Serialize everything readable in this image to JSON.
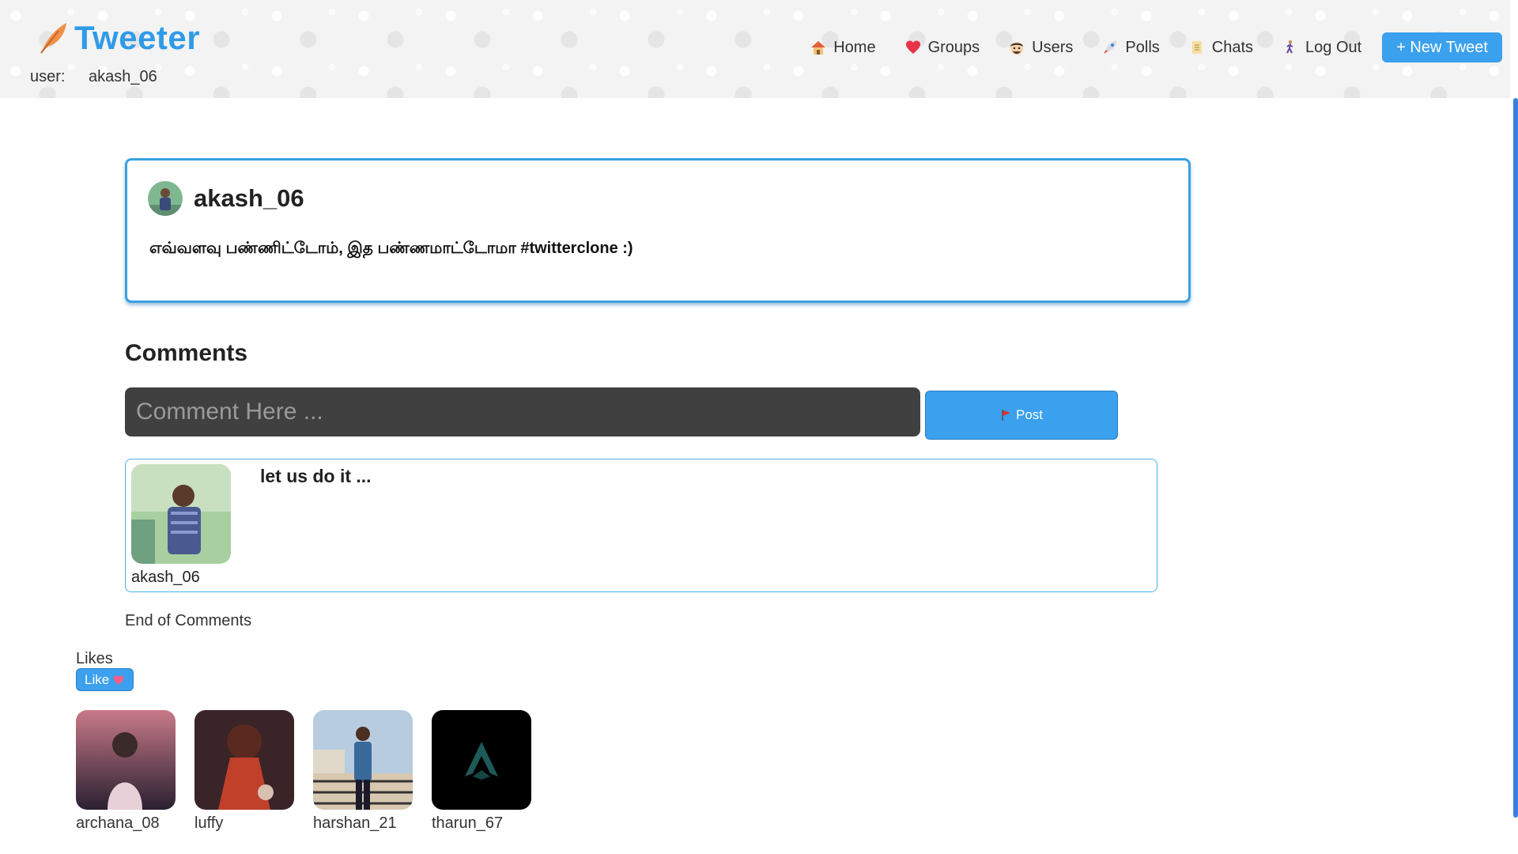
{
  "app": {
    "title": "Tweeter"
  },
  "user": {
    "label": "user:",
    "name": "akash_06"
  },
  "nav": {
    "items": [
      {
        "label": "Home",
        "icon": "house-icon"
      },
      {
        "label": "Groups",
        "icon": "heart-icon"
      },
      {
        "label": "Users",
        "icon": "face-icon"
      },
      {
        "label": "Polls",
        "icon": "rocket-icon"
      },
      {
        "label": "Chats",
        "icon": "scroll-icon"
      },
      {
        "label": "Log Out",
        "icon": "person-walking-icon"
      }
    ],
    "new_tweet": "+ New Tweet"
  },
  "tweet": {
    "author": "akash_06",
    "text": "எவ்வளவு பண்ணிட்டோம், இத பண்ணமாட்டோமா #twitterclone :)"
  },
  "comments": {
    "title": "Comments",
    "input_placeholder": "Comment Here ...",
    "post_label": "Post",
    "items": [
      {
        "user": "akash_06",
        "text": "let us do it ..."
      }
    ],
    "end_text": "End of Comments"
  },
  "likes": {
    "label": "Likes",
    "button_label": "Like",
    "users": [
      {
        "name": "archana_08"
      },
      {
        "name": "luffy"
      },
      {
        "name": "harshan_21"
      },
      {
        "name": "tharun_67"
      }
    ]
  },
  "colors": {
    "accent": "#3ba0ee",
    "logo": "#2f9be8",
    "input_bg": "#404040",
    "card_border": "#3aa0e0"
  }
}
